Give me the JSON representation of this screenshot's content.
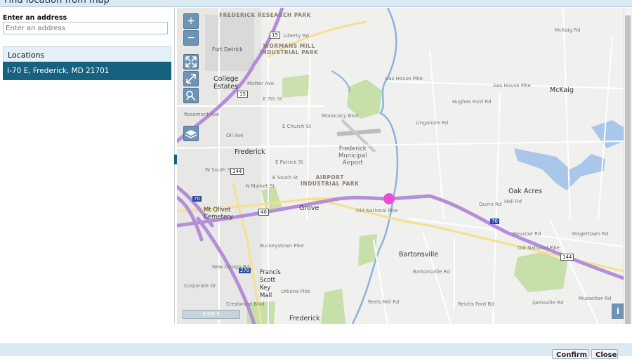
{
  "window": {
    "title": "Find location from map"
  },
  "address": {
    "label": "Enter an address",
    "placeholder": "Enter an address"
  },
  "locations": {
    "header": "Locations",
    "items": [
      "I-70 E, Frederick, MD 21701"
    ]
  },
  "map": {
    "controls": {
      "zoom_in": "+",
      "zoom_out": "−"
    },
    "scale_label": "5000 ft",
    "info_label": "i",
    "labels": {
      "frederick_research_park": "FREDERICK RESEARCH PARK",
      "wormans_mill": "WORMANS MILL\nINDUSTRIAL PARK",
      "fort_detrick": "Fort Detrick",
      "college_estates": "College\nEstates",
      "frederick": "Frederick",
      "frederick_airport": "Frederick\nMunicipal\nAirport",
      "airport_industrial": "AIRPORT\nINDUSTRIAL PARK",
      "grove": "Grove",
      "mt_olivet": "Mt Olivet\nCemetery",
      "francis_scott": "Francis\nScott\nKey\nMall",
      "bartonsville": "Bartonsville",
      "oak_acres": "Oak Acres",
      "mckaig": "McKaig",
      "frederick_bottom": "Frederick",
      "liberty_rd": "Liberty Rd",
      "gas_house_pike": "Gas House Pike",
      "gas_house_pike_2": "Gas House Pike",
      "old_national_pike": "Old National Pike",
      "old_national_pike_2": "Old National Pike",
      "e_church_st": "E Church St",
      "e_patrick_st": "E Patrick St",
      "e_south_st": "E South St",
      "w_south_st": "W South St",
      "oil_ave": "Oil Ave",
      "rosemont_ave": "Rosemont Ave",
      "market_st": "N Market St",
      "e_7th_st": "E 7th St",
      "monocacy_blvd": "Monocacy Blvd",
      "buckeystown_pike": "Buckeystown Pike",
      "urbana_pike": "Urbana Pike",
      "reichs_ford_rd": "Reichs Ford Rd",
      "linganore_rd": "Linganore Rd",
      "mckaig_rd": "McKaig Rd",
      "hall_rd": "Hall Rd",
      "meadow_rd": "Meadow Rd",
      "yeagertown_rd": "Yeagertown Rd",
      "mussetter_rd": "Mussetter Rd",
      "new_design_rd": "New Design Rd",
      "corporate_dr": "Corporate Dr",
      "crestwood_blvd": "Crestwood Blvd",
      "hughes_ford_rd": "Hughes Ford Rd",
      "reels_mill_rd": "Reels Mill Rd",
      "ijamsville_rd": "Ijamsville Rd",
      "bartonsville_rd": "Bartonsville Rd",
      "quinn_rd": "Quinn Rd",
      "mutter_ave": "Motter Ave"
    },
    "shields": {
      "r15a": "15",
      "r15b": "15",
      "r144a": "144",
      "r40": "40",
      "r70a": "70",
      "r70b": "70",
      "r270": "270",
      "r144b": "144"
    }
  },
  "buttons": {
    "confirm": "Confirm",
    "close": "Close"
  },
  "colors": {
    "accent": "#16627f",
    "highway": "#b48ed8",
    "marker": "#e84fd6",
    "water": "#a9c7ea",
    "park": "#c7dfa8"
  }
}
